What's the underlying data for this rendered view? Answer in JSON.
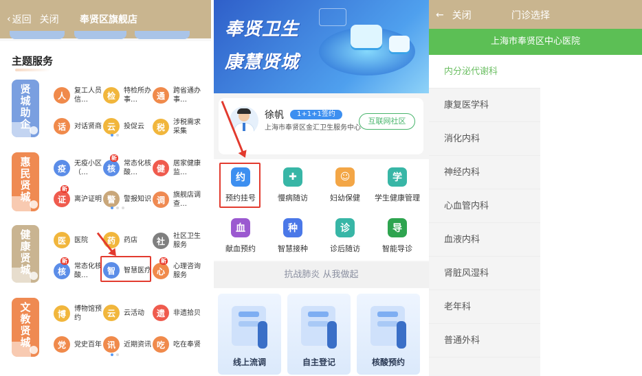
{
  "panel1": {
    "header": {
      "back_label": "返回",
      "close_label": "关闭",
      "title": "奉贤区旗舰店"
    },
    "section_title": "主题服务",
    "categories": [
      {
        "label": "贤城助企",
        "chars": [
          "贤",
          "城",
          "助",
          "企"
        ],
        "color": "#7a9fe0"
      },
      {
        "label": "惠民贤城",
        "chars": [
          "惠",
          "民",
          "贤",
          "城"
        ],
        "color": "#ef8a52"
      },
      {
        "label": "健康贤城",
        "chars": [
          "健",
          "康",
          "贤",
          "城"
        ],
        "color": "#c9b491"
      },
      {
        "label": "文教贤城",
        "chars": [
          "文",
          "教",
          "贤",
          "城"
        ],
        "color": "#ef8a52"
      }
    ],
    "services": [
      {
        "label": "复工人员信…",
        "color": "#f08a4b",
        "glyph": "人"
      },
      {
        "label": "特检所办事…",
        "color": "#f1b63c",
        "glyph": "检"
      },
      {
        "label": "跨省通办事…",
        "color": "#f08a4b",
        "glyph": "通"
      },
      {
        "label": "对话贤商",
        "color": "#f08a4b",
        "glyph": "话"
      },
      {
        "label": "投促云",
        "color": "#f1b63c",
        "glyph": "云"
      },
      {
        "label": "涉税需求采集",
        "color": "#f1b63c",
        "glyph": "税"
      },
      {
        "label": "无疫小区（…",
        "color": "#5b8de8",
        "glyph": "疫"
      },
      {
        "label": "常态化核酸…",
        "color": "#5b8de8",
        "glyph": "核",
        "badge": "新"
      },
      {
        "label": "居家健康监…",
        "color": "#ef5b4e",
        "glyph": "健"
      },
      {
        "label": "离沪证明",
        "color": "#ef5b4e",
        "glyph": "证",
        "badge": "新"
      },
      {
        "label": "警报知识",
        "color": "#c9a77a",
        "glyph": "警"
      },
      {
        "label": "旗舰店调查…",
        "color": "#ef8a52",
        "glyph": "调"
      },
      {
        "label": "医院",
        "color": "#f1b63c",
        "glyph": "医"
      },
      {
        "label": "药店",
        "color": "#f1b63c",
        "glyph": "药"
      },
      {
        "label": "社区卫生服务",
        "color": "#7f7f7f",
        "glyph": "社"
      },
      {
        "label": "常态化核酸…",
        "color": "#5b8de8",
        "glyph": "核",
        "badge": "新"
      },
      {
        "label": "智慧医疗",
        "color": "#5b8de8",
        "glyph": "智"
      },
      {
        "label": "心理咨询服务",
        "color": "#f08a4b",
        "glyph": "心",
        "badge": "新"
      },
      {
        "label": "博物馆预约",
        "color": "#f1b63c",
        "glyph": "博"
      },
      {
        "label": "云活动",
        "color": "#f1b63c",
        "glyph": "云"
      },
      {
        "label": "非遗拾贝",
        "color": "#ef5b4e",
        "glyph": "遗"
      },
      {
        "label": "党史百年",
        "color": "#f08a4b",
        "glyph": "党"
      },
      {
        "label": "近期资讯",
        "color": "#f08a4b",
        "glyph": "讯"
      },
      {
        "label": "吃在奉贤",
        "color": "#f08a4b",
        "glyph": "吃"
      }
    ]
  },
  "panel2": {
    "banner_line1": "奉贤卫生",
    "banner_line2": "康慧贤城",
    "doctor": {
      "name": "徐帆",
      "tag": "1+1+1签约",
      "org": "上海市奉贤区金汇卫生服务中心",
      "button": "互联网社区"
    },
    "grid": [
      {
        "label": "预约挂号",
        "color": "#3d8ff0",
        "glyph": "约"
      },
      {
        "label": "慢病随访",
        "color": "#38b6a6",
        "glyph": "✚"
      },
      {
        "label": "妇幼保健",
        "color": "#f3a646",
        "glyph": "☺"
      },
      {
        "label": "学生健康管理",
        "color": "#38b6a6",
        "glyph": "学"
      },
      {
        "label": "献血预约",
        "color": "#9b59d0",
        "glyph": "血"
      },
      {
        "label": "智慧接种",
        "color": "#4a78e8",
        "glyph": "种"
      },
      {
        "label": "诊后随访",
        "color": "#38b6a6",
        "glyph": "诊"
      },
      {
        "label": "智能导诊",
        "color": "#2ea44f",
        "glyph": "导"
      }
    ],
    "slogan": "抗战肺炎 从我做起",
    "cards": [
      "线上流调",
      "自主登记",
      "核酸预约"
    ]
  },
  "panel3": {
    "header": {
      "close_label": "关闭",
      "title": "门诊选择"
    },
    "hospital": "上海市奉贤区中心医院",
    "departments": [
      "内分泌代谢科",
      "康复医学科",
      "消化内科",
      "神经内科",
      "心血管内科",
      "血液内科",
      "肾脏风湿科",
      "老年科",
      "普通外科"
    ],
    "selected_index": 0
  }
}
